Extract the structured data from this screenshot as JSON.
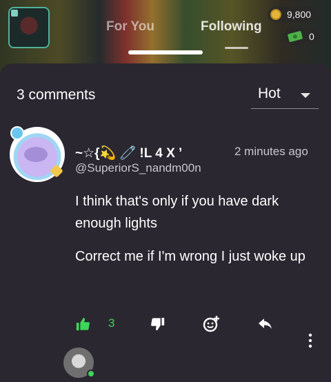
{
  "header": {
    "tab_for_you": "For You",
    "tab_following": "Following",
    "coins": "9,800",
    "cash": "0"
  },
  "comments_panel": {
    "count_label": "3 comments",
    "sort": {
      "selected": "Hot"
    }
  },
  "comment": {
    "display_name": "~☆{💫 🧷 !L 4 X ’",
    "timestamp": "2 minutes ago",
    "handle": "@SuperiorS_nandm00n",
    "paragraphs": [
      "I think that's only if you have dark enough lights",
      "Correct me if I'm wrong I just woke up"
    ],
    "likes": "3"
  },
  "colors": {
    "background": "#2a2730",
    "accent_green": "#3ed65a",
    "secondary_text": "#c9c6cf"
  },
  "icons": {
    "coin": "coin-icon",
    "cash": "cash-icon",
    "like": "thumbs-up-icon",
    "dislike": "thumbs-down-icon",
    "react": "add-reaction-icon",
    "reply": "reply-icon",
    "more": "more-vertical-icon"
  }
}
